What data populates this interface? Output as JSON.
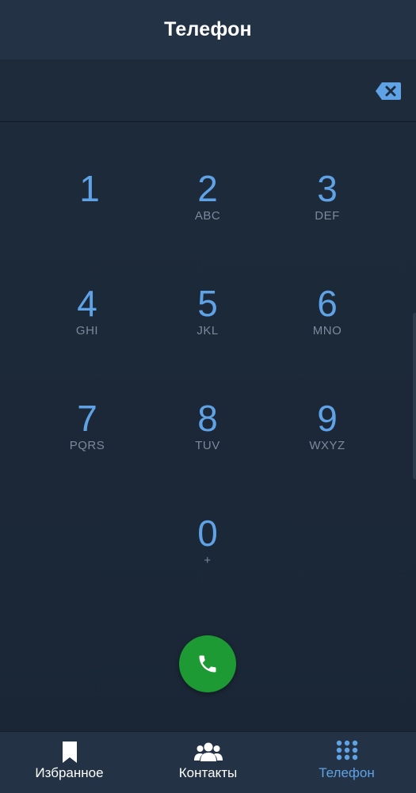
{
  "app_bar": {
    "title": "Телефон"
  },
  "number_display": {
    "value": ""
  },
  "keypad": {
    "keys": [
      {
        "digit": "1",
        "letters": ""
      },
      {
        "digit": "2",
        "letters": "ABC"
      },
      {
        "digit": "3",
        "letters": "DEF"
      },
      {
        "digit": "4",
        "letters": "GHI"
      },
      {
        "digit": "5",
        "letters": "JKL"
      },
      {
        "digit": "6",
        "letters": "MNO"
      },
      {
        "digit": "7",
        "letters": "PQRS"
      },
      {
        "digit": "8",
        "letters": "TUV"
      },
      {
        "digit": "9",
        "letters": "WXYZ"
      },
      {
        "digit": "0",
        "letters": "+"
      }
    ]
  },
  "icons": {
    "backspace": "backspace-icon",
    "call": "phone-icon",
    "favorites": "bookmark-icon",
    "contacts": "people-icon",
    "phone": "dialpad-icon"
  },
  "bottom_nav": {
    "items": [
      {
        "label": "Избранное",
        "active": false
      },
      {
        "label": "Контакты",
        "active": false
      },
      {
        "label": "Телефон",
        "active": true
      }
    ]
  },
  "colors": {
    "accent": "#5fa3e6",
    "call_button": "#1e9a34",
    "app_bar": "#233345",
    "background": "#1e2b3b"
  }
}
